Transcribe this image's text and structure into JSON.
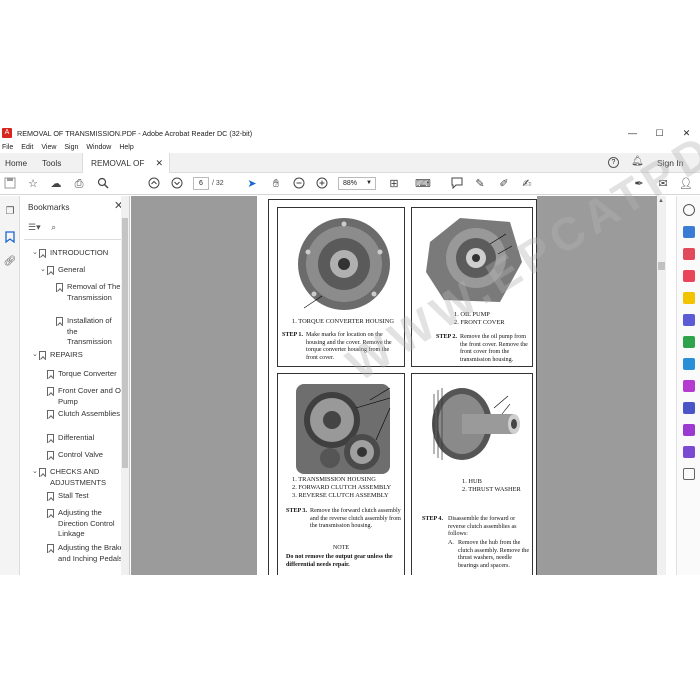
{
  "window": {
    "title": "REMOVAL OF TRANSMISSION.PDF - Adobe Acrobat Reader DC (32-bit)",
    "app_icon": "acrobat-icon",
    "controls": [
      "—",
      "☐",
      "✕"
    ]
  },
  "menu": [
    "File",
    "Edit",
    "View",
    "Sign",
    "Window",
    "Help"
  ],
  "tabs": {
    "home": "Home",
    "tools": "Tools",
    "document": "REMOVAL OF TRA...",
    "sign_in": "Sign In"
  },
  "toolbar": {
    "current_page": "6",
    "total_pages": "/ 32",
    "zoom": "88%"
  },
  "bookmarks": {
    "header": "Bookmarks",
    "items": [
      {
        "label": "INTRODUCTION",
        "level": 0,
        "expanded": true
      },
      {
        "label": "General",
        "level": 1,
        "expanded": true
      },
      {
        "label": "Removal of The Transmission",
        "level": 2
      },
      {
        "label": "Installation of the Transmission",
        "level": 2
      },
      {
        "label": "REPAIRS",
        "level": 0,
        "expanded": true
      },
      {
        "label": "Torque Converter",
        "level": 1
      },
      {
        "label": "Front Cover and Oil Pump",
        "level": 1
      },
      {
        "label": "Clutch Assemblies",
        "level": 1
      },
      {
        "label": "Differential",
        "level": 1
      },
      {
        "label": "Control Valve",
        "level": 1
      },
      {
        "label": "CHECKS AND ADJUSTMENTS",
        "level": 0,
        "expanded": true
      },
      {
        "label": "Stall Test",
        "level": 1
      },
      {
        "label": "Adjusting the Direction Control Linkage",
        "level": 1
      },
      {
        "label": "Adjusting the Brake and Inching Pedals",
        "level": 1
      }
    ]
  },
  "document": {
    "watermark": "WWW.EPCATPDF.COM",
    "panel1": {
      "caption": "1. TORQUE CONVERTER HOUSING",
      "step_label": "STEP 1.",
      "step_text": "Make marks for location on the housing and the cover. Remove the torque converter housing from the front cover."
    },
    "panel2": {
      "caption_1": "1. OIL PUMP",
      "caption_2": "2. FRONT COVER",
      "step_label": "STEP 2.",
      "step_text": "Remove the oil pump from the front cover. Remove the front cover from the transmission housing."
    },
    "panel3": {
      "caption_1": "1. TRANSMISSION HOUSING",
      "caption_2": "2. FORWARD CLUTCH ASSEMBLY",
      "caption_3": "3. REVERSE CLUTCH ASSEMBLY",
      "step_label": "STEP 3.",
      "step_text": "Remove the forward clutch assembly and the reverse clutch assembly from the transmission housing.",
      "note_title": "NOTE",
      "note_text": "Do not remove the output gear unless the differential needs repair."
    },
    "panel4": {
      "caption_1": "1. HUB",
      "caption_2": "2. THRUST WASHER",
      "step_label": "STEP 4.",
      "step_text": "Disassemble the forward or reverse clutch assemblies as follows:",
      "sub_label": "A.",
      "sub_text": "Remove the hub from the clutch assembly. Remove the thrust washers, needle bearings and spacers."
    }
  }
}
